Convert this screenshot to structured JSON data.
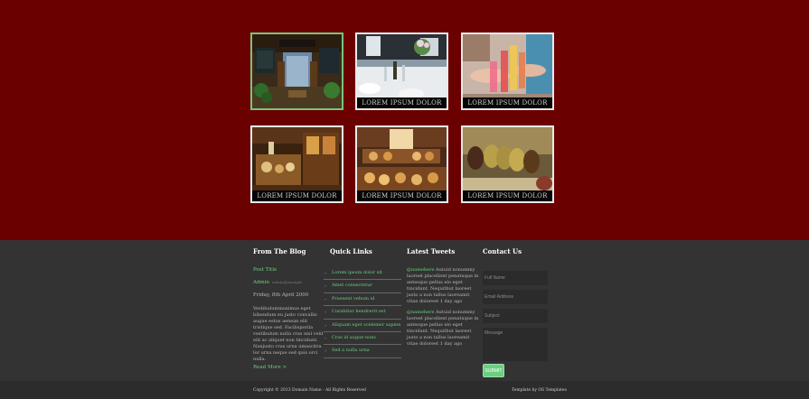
{
  "gallery": {
    "captions": [
      "LOREM IPSUM DOLOR",
      "LOREM IPSUM DOLOR",
      "LOREM IPSUM DOLOR",
      "LOREM IPSUM DOLOR",
      "LOREM IPSUM DOLOR"
    ]
  },
  "blog": {
    "title": "From The Blog",
    "post_title": "Post Title",
    "admin": "Admin",
    "admin_tag": "admin@example",
    "date": "Friday, 8th April 2000",
    "body": "Vestibulummaximus eget bibendum eu justo convallis augue estus aenean elit tristique sed. Facilisporila vestibulum nulla cras nisl velit elit ac aliquet non tincidunt. Nanjusto cras urna umascitra lor urna neque sed quis orci nulla.",
    "read_more": "Read More >"
  },
  "quick_links": {
    "title": "Quick Links",
    "items": [
      "Lorem ipsum dolor sit",
      "Amet consectetur",
      "Praesent vehum id",
      "Curabitur hendrerit est",
      "Aliquam eget scelemer sapien",
      "Cras id augue nunc",
      "Sed a nulla urna"
    ]
  },
  "tweets": {
    "title": "Latest Tweets",
    "items": [
      {
        "handle": "@namehere",
        "text": "Autuid nonummy laoreet placellent penatuque in antesque pellus elo eget tincidunt. Nequitbut laoreet justo a non tallus laoreamit vitae doloreet",
        "time": "1 day ago"
      },
      {
        "handle": "@namehere",
        "text": "Autuid nonummy laoreet placellent penatuque in antesque pellus elo eget tincidunt. Nequitbut laoreet justo a non tallus laoreamit vitae doloreet",
        "time": "1 day ago"
      }
    ]
  },
  "contact": {
    "title": "Contact Us",
    "full_name_placeholder": "Full Name",
    "email_placeholder": "Email Address",
    "subject_placeholder": "Subject",
    "message_placeholder": "Message",
    "submit_label": "SUBMIT"
  },
  "footer": {
    "copyright": "Copyright © 2013 Domain Name - All Rights Reserved",
    "template_by": "Template by OS Templates"
  },
  "colors": {
    "hero_background": "#6b0000",
    "footer_background": "#333333",
    "accent": "#6ccf7f"
  }
}
